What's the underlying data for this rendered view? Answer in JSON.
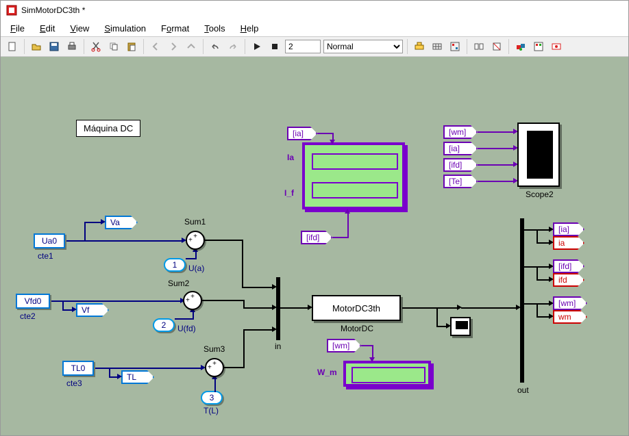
{
  "title": "SimMotorDC3th *",
  "menus": {
    "file": "File",
    "edit": "Edit",
    "view": "View",
    "simulation": "Simulation",
    "format": "Format",
    "tools": "Tools",
    "help": "Help"
  },
  "toolbar": {
    "stop_time": "2",
    "mode": "Normal"
  },
  "diagram": {
    "title_box": "Máquina DC",
    "consts": {
      "ua0": "Ua0",
      "vfd0": "Vfd0",
      "tl0": "TL0"
    },
    "cte_labels": {
      "cte1": "cte1",
      "cte2": "cte2",
      "cte3": "cte3"
    },
    "gotos": {
      "va": "Va",
      "vf": "Vf",
      "tl": "TL"
    },
    "inports": {
      "p1": "1",
      "p2": "2",
      "p3": "3"
    },
    "inport_labels": {
      "ua": "U(a)",
      "ufd": "U(fd)",
      "tl": "T(L)"
    },
    "sums": {
      "s1": "Sum1",
      "s2": "Sum2",
      "s3": "Sum3"
    },
    "mux_in_label": "in",
    "motor_block": "MotorDC3th",
    "motor_label": "MotorDC",
    "demux_out_label": "out",
    "scope2_label": "Scope2",
    "scope2_inputs": {
      "wm": "[wm]",
      "ia": "[ia]",
      "ifd": "[ifd]",
      "te": "[Te]"
    },
    "disp1_labels": {
      "ia": "Ia",
      "if": "I_f"
    },
    "disp1_inputs": {
      "ia": "[ia]",
      "ifd": "[ifd]"
    },
    "disp2_label": "W_m",
    "disp2_input": "[wm]",
    "out_tags": {
      "ia_p": "[ia]",
      "ia_r": "ia",
      "ifd_p": "[ifd]",
      "ifd_r": "ifd",
      "wm_p": "[wm]",
      "wm_r": "wm"
    }
  }
}
